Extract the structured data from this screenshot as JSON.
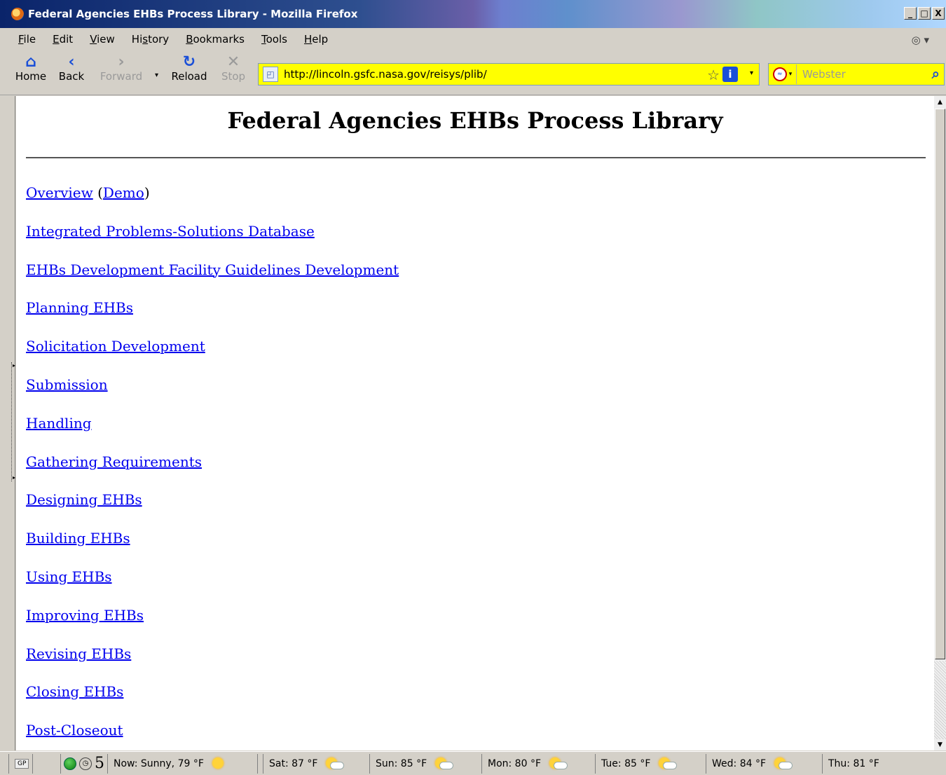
{
  "window": {
    "title": "Federal Agencies EHBs Process Library - Mozilla Firefox",
    "controls": {
      "minimize": "_",
      "maximize": "□",
      "close": "X"
    }
  },
  "menu": {
    "items": [
      {
        "label": "File",
        "accel": "F",
        "rest": "ile"
      },
      {
        "label": "Edit",
        "accel": "E",
        "rest": "dit"
      },
      {
        "label": "View",
        "accel": "V",
        "rest": "iew"
      },
      {
        "label": "History",
        "pre": "Hi",
        "accel": "s",
        "rest": "tory"
      },
      {
        "label": "Bookmarks",
        "accel": "B",
        "rest": "ookmarks"
      },
      {
        "label": "Tools",
        "accel": "T",
        "rest": "ools"
      },
      {
        "label": "Help",
        "accel": "H",
        "rest": "elp"
      }
    ]
  },
  "toolbar": {
    "home_label": "Home",
    "back_label": "Back",
    "forward_label": "Forward",
    "reload_label": "Reload",
    "stop_label": "Stop",
    "url": "http://lincoln.gsfc.nasa.gov/reisys/plib/",
    "search_placeholder": "Webster",
    "accent_color": "#1a4fd8",
    "urlbar_color": "#ffff00"
  },
  "page": {
    "heading": "Federal Agencies EHBs Process Library",
    "overview_link": "Overview",
    "demo_link": "Demo",
    "open_paren": " (",
    "close_paren": ")",
    "links": [
      "Integrated Problems-Solutions Database",
      "EHBs Development Facility Guidelines Development",
      "Planning EHBs",
      "Solicitation Development",
      "Submission",
      "Handling",
      "Gathering Requirements",
      "Designing EHBs",
      "Building EHBs",
      "Using EHBs",
      "Improving EHBs",
      "Revising EHBs",
      "Closing EHBs",
      "Post-Closeout"
    ],
    "link_color": "#0000ee"
  },
  "statusbar": {
    "gp_label": "GP",
    "counter": "5",
    "now": "Now: Sunny, 79 °F",
    "forecast": [
      {
        "label": "Sat: 87 °F"
      },
      {
        "label": "Sun: 85 °F"
      },
      {
        "label": "Mon: 80 °F"
      },
      {
        "label": "Tue: 85 °F"
      },
      {
        "label": "Wed: 84 °F"
      },
      {
        "label": "Thu: 81 °F"
      }
    ]
  }
}
